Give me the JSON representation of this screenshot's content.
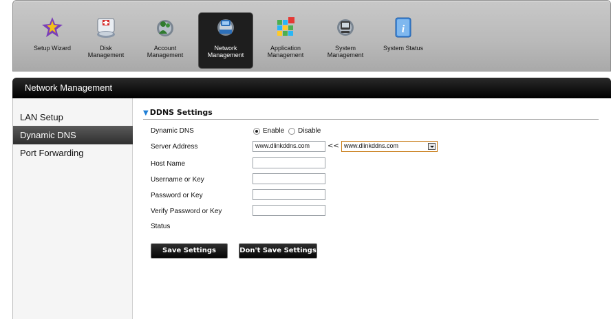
{
  "toolbar": {
    "items": [
      {
        "label": "Setup Wizard",
        "icon": "wizard-icon"
      },
      {
        "label": "Disk\nManagement",
        "icon": "disk-icon"
      },
      {
        "label": "Account\nManagement",
        "icon": "account-icon"
      },
      {
        "label": "Network\nManagement",
        "icon": "network-icon"
      },
      {
        "label": "Application\nManagement",
        "icon": "application-icon"
      },
      {
        "label": "System\nManagement",
        "icon": "system-icon"
      },
      {
        "label": "System Status",
        "icon": "info-icon"
      }
    ],
    "active_index": 3
  },
  "header": {
    "title": "Network Management"
  },
  "sidebar": {
    "items": [
      {
        "label": "LAN Setup"
      },
      {
        "label": "Dynamic DNS"
      },
      {
        "label": "Port Forwarding"
      }
    ],
    "active_index": 1
  },
  "ddns": {
    "title": "DDNS Settings",
    "dynamic_dns_label": "Dynamic DNS",
    "enable_label": "Enable",
    "disable_label": "Disable",
    "enabled": true,
    "server_address_label": "Server Address",
    "server_address_value": "www.dlinkddns.com",
    "copy_arrows": "<<",
    "server_select_value": "www.dlinkddns.com",
    "host_name_label": "Host Name",
    "host_name_value": "",
    "username_label": "Username or Key",
    "username_value": "",
    "password_label": "Password or Key",
    "password_value": "",
    "verify_label": "Verify Password or Key",
    "verify_value": "",
    "status_label": "Status"
  },
  "buttons": {
    "save": "Save Settings",
    "dont_save": "Don't Save Settings"
  },
  "colors": {
    "accent": "#1f7fd6",
    "header_bg": "#000000",
    "active_item": "#3a3a3a",
    "select_border": "#c77a14"
  }
}
